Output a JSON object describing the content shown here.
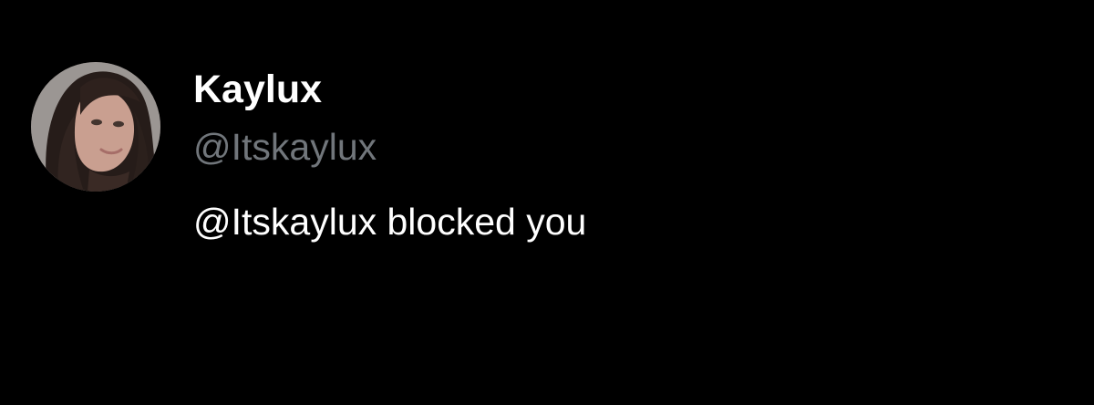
{
  "profile": {
    "display_name": "Kaylux",
    "handle": "@Itskaylux",
    "status_message": "@Itskaylux blocked you",
    "avatar_icon": "user-avatar-photo"
  },
  "colors": {
    "background": "#000000",
    "name": "#ffffff",
    "handle": "#71767b",
    "message": "#ffffff"
  }
}
